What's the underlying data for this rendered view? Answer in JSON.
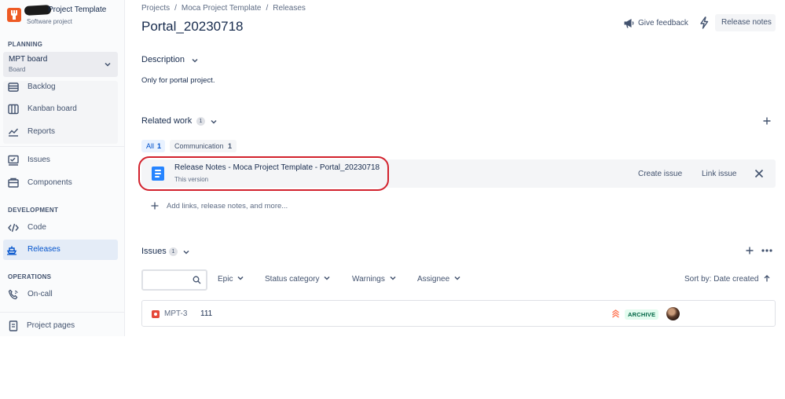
{
  "project": {
    "name": "Project Template",
    "type": "Software project",
    "logo_color": "#ee5a24"
  },
  "sidebar": {
    "planning_heading": "PLANNING",
    "board": {
      "title": "MPT board",
      "subtitle": "Board"
    },
    "planning_items": [
      {
        "label": "Backlog",
        "icon": "backlog-icon"
      },
      {
        "label": "Kanban board",
        "icon": "kanban-board-icon"
      },
      {
        "label": "Reports",
        "icon": "reports-icon"
      }
    ],
    "other_items": [
      {
        "label": "Issues",
        "icon": "issues-icon"
      },
      {
        "label": "Components",
        "icon": "components-icon"
      }
    ],
    "development_heading": "DEVELOPMENT",
    "development_items": [
      {
        "label": "Code",
        "icon": "code-icon"
      },
      {
        "label": "Releases",
        "icon": "releases-icon",
        "active": true
      }
    ],
    "operations_heading": "OPERATIONS",
    "operations_items": [
      {
        "label": "On-call",
        "icon": "on-call-icon"
      }
    ],
    "project_pages": {
      "label": "Project pages",
      "icon": "project-pages-icon"
    }
  },
  "breadcrumbs": [
    "Projects",
    "Moca Project Template",
    "Releases"
  ],
  "page_title": "Portal_20230718",
  "header_actions": {
    "give_feedback": "Give feedback",
    "release_notes": "Release notes"
  },
  "description": {
    "heading": "Description",
    "text": "Only for portal project."
  },
  "related_work": {
    "heading": "Related work",
    "count": "1",
    "filters": [
      {
        "label": "All",
        "count": "1",
        "active": true
      },
      {
        "label": "Communication",
        "count": "1",
        "active": false
      }
    ],
    "item": {
      "title": "Release Notes - Moca Project Template - Portal_20230718",
      "subtitle": "This version",
      "create_issue": "Create issue",
      "link_issue": "Link issue"
    },
    "add_link_text": "Add links, release notes, and more..."
  },
  "issues": {
    "heading": "Issues",
    "count": "1",
    "search": {
      "value": "",
      "placeholder": ""
    },
    "filters": [
      "Epic",
      "Status category",
      "Warnings",
      "Assignee"
    ],
    "sort_label": "Sort by: Date created",
    "rows": [
      {
        "key": "MPT-3",
        "summary": "111",
        "status": "ARCHIVE",
        "type": "bug-icon",
        "priority": "highest-priority-icon"
      }
    ]
  },
  "colors": {
    "accent": "#0052cc",
    "status_green_bg": "#e3fcef",
    "status_green_fg": "#006644",
    "annotation_red": "#d2222d"
  }
}
